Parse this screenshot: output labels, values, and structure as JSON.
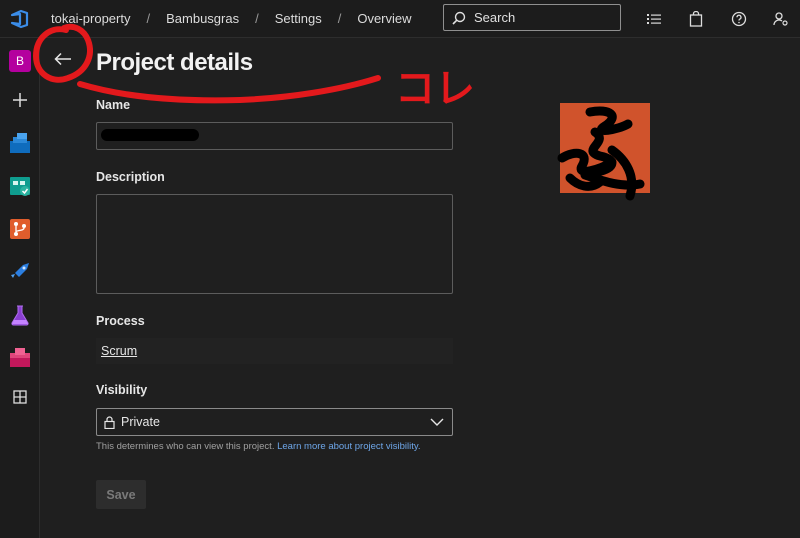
{
  "header": {
    "breadcrumb": [
      "tokai-property",
      "Bambusgras",
      "Settings",
      "Overview"
    ],
    "search_placeholder": "Search"
  },
  "page": {
    "title": "Project details"
  },
  "form": {
    "name_label": "Name",
    "description_label": "Description",
    "process_label": "Process",
    "process_value": "Scrum",
    "visibility_label": "Visibility",
    "visibility_value": "Private",
    "hint_text": "This determines who can view this project. ",
    "hint_link": "Learn more about project visibility.",
    "save_label": "Save"
  },
  "annotation": {
    "text": "コレ",
    "color": "#e3191c"
  },
  "sidebar": {
    "project_initial": "B"
  },
  "colors": {
    "project_avatar": "#d0532c",
    "link": "#6ea6e8",
    "project_tile": "#b4009e"
  }
}
